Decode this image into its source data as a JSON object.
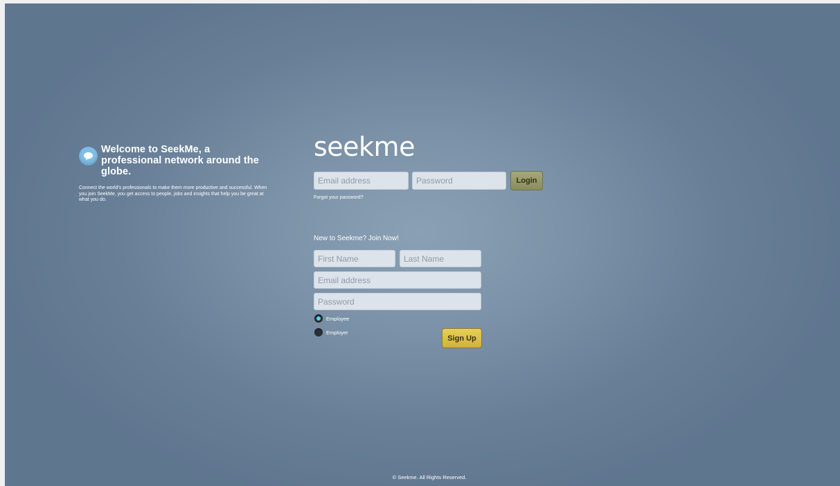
{
  "welcome": {
    "icon": "chat-bubble-icon",
    "title": "Welcome to SeekMe, a professional network around the globe.",
    "text": "Connect the world's professionals to make them more productive and successful. When you join SeekMe, you get access to people, jobs and insights that help you be great at what you do."
  },
  "brand": "seekme",
  "login": {
    "email_placeholder": "Email address",
    "password_placeholder": "Password",
    "button_label": "Login",
    "forgot_label": "Forgot your password?"
  },
  "signup": {
    "heading": "New to Seekme? Join Now!",
    "first_name_placeholder": "First Name",
    "last_name_placeholder": "Last Name",
    "email_placeholder": "Email address",
    "password_placeholder": "Password",
    "options": [
      {
        "label": "Employee",
        "selected": true
      },
      {
        "label": "Employer",
        "selected": false
      }
    ],
    "button_label": "Sign Up"
  },
  "footer": "© Seekme. All Rights Reserved.",
  "colors": {
    "background": "#7b92a8",
    "login_button": "#9a9c6b",
    "signup_button": "#dcc04a",
    "radio_selected": "#4fd6e0",
    "icon": "#7fbde6"
  }
}
